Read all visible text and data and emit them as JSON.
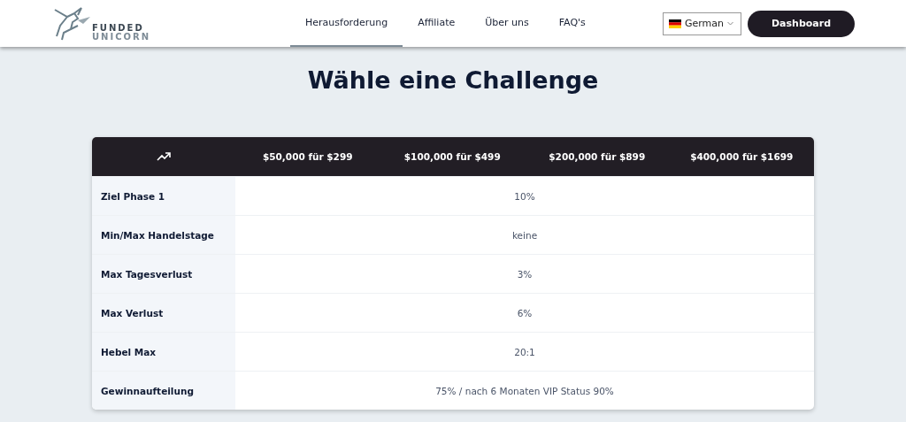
{
  "logo": {
    "line_1": "FUNDED",
    "line_2": "UNICORN"
  },
  "nav": [
    {
      "label": "Herausforderung",
      "selected": true
    },
    {
      "label": "Affiliate",
      "selected": false
    },
    {
      "label": "Über uns",
      "selected": false
    },
    {
      "label": "FAQ's",
      "selected": false
    }
  ],
  "language": {
    "value": "German"
  },
  "dashboard_button": "Dashboard",
  "title": "Wähle eine Challenge",
  "table": {
    "columns": [
      "$50,000 für $299",
      "$100,000 für $499",
      "$200,000 für $899",
      "$400,000 für $1699"
    ],
    "rows": [
      {
        "label": "Ziel Phase 1",
        "value": "10%"
      },
      {
        "label": "Min/Max Handelstage",
        "value": "keine"
      },
      {
        "label": "Max Tagesverlust",
        "value": "3%"
      },
      {
        "label": "Max Verlust",
        "value": "6%"
      },
      {
        "label": "Hebel Max",
        "value": "20:1"
      },
      {
        "label": "Gewinnaufteilung",
        "value": "75% / nach 6 Monaten VIP Status 90%"
      }
    ]
  }
}
